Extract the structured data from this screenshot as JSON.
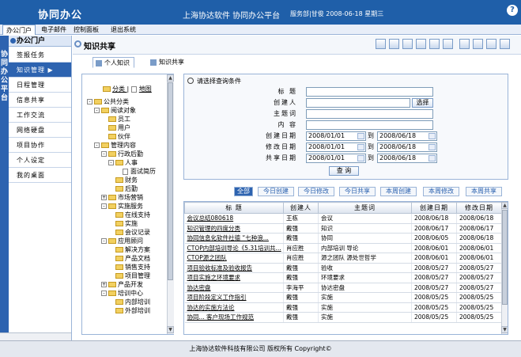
{
  "header": {
    "app_title": "协同办公",
    "platform_title": "上海协达软件 协同办公平台",
    "status": "服务部|甘俊 2008-06-18 星期三",
    "help_icon": "?"
  },
  "topmenu": {
    "items": [
      {
        "label": "办公门户"
      },
      {
        "label": "电子邮件"
      },
      {
        "label": "控制面板"
      },
      {
        "label": "退出系统"
      }
    ]
  },
  "leftnav": {
    "vertical_tab": "协同办公平台",
    "head": "办公门户",
    "items": [
      {
        "label": "签报任务"
      },
      {
        "label": "知识管理 ▶"
      },
      {
        "label": "日程管理"
      },
      {
        "label": "信息共享"
      },
      {
        "label": "工作交流"
      },
      {
        "label": "网络硬盘"
      },
      {
        "label": "项目协作"
      },
      {
        "label": "个人设定"
      },
      {
        "label": "我的桌面"
      }
    ]
  },
  "content": {
    "title": "知识共享",
    "tabs": [
      {
        "label": "个人知识"
      },
      {
        "label": "知识共享"
      }
    ]
  },
  "tree": {
    "switch_category": "分类",
    "switch_map": "地图",
    "nodes": [
      {
        "label": "公共分类",
        "level": 0,
        "type": "folder",
        "expander": "-"
      },
      {
        "label": "阅读对象",
        "level": 1,
        "type": "folder",
        "expander": "-"
      },
      {
        "label": "员工",
        "level": 2,
        "type": "folder",
        "expander": ""
      },
      {
        "label": "用户",
        "level": 2,
        "type": "folder",
        "expander": ""
      },
      {
        "label": "伙伴",
        "level": 2,
        "type": "folder",
        "expander": ""
      },
      {
        "label": "管理内容",
        "level": 1,
        "type": "folder",
        "expander": "-"
      },
      {
        "label": "行政后勤",
        "level": 2,
        "type": "folder",
        "expander": "-"
      },
      {
        "label": "人事",
        "level": 3,
        "type": "folder",
        "expander": "-"
      },
      {
        "label": "面试简历",
        "level": 4,
        "type": "leaf",
        "expander": ""
      },
      {
        "label": "财务",
        "level": 3,
        "type": "folder",
        "expander": ""
      },
      {
        "label": "后勤",
        "level": 3,
        "type": "folder",
        "expander": ""
      },
      {
        "label": "市场营销",
        "level": 2,
        "type": "folder",
        "expander": "+"
      },
      {
        "label": "实施服务",
        "level": 2,
        "type": "folder",
        "expander": "-"
      },
      {
        "label": "在线支持",
        "level": 3,
        "type": "folder",
        "expander": ""
      },
      {
        "label": "实施",
        "level": 3,
        "type": "folder",
        "expander": ""
      },
      {
        "label": "会议记录",
        "level": 3,
        "type": "folder",
        "expander": ""
      },
      {
        "label": "应用顾问",
        "level": 2,
        "type": "folder",
        "expander": "-"
      },
      {
        "label": "解决方案",
        "level": 3,
        "type": "folder",
        "expander": ""
      },
      {
        "label": "产品文档",
        "level": 3,
        "type": "folder",
        "expander": ""
      },
      {
        "label": "销售支持",
        "level": 3,
        "type": "folder",
        "expander": ""
      },
      {
        "label": "项目管理",
        "level": 3,
        "type": "folder",
        "expander": ""
      },
      {
        "label": "产品开发",
        "level": 2,
        "type": "folder",
        "expander": "+"
      },
      {
        "label": "培训中心",
        "level": 2,
        "type": "folder",
        "expander": "-"
      },
      {
        "label": "内部培训",
        "level": 3,
        "type": "folder",
        "expander": ""
      },
      {
        "label": "外部培训",
        "level": 3,
        "type": "folder",
        "expander": ""
      }
    ]
  },
  "search": {
    "title": "请选择查询条件",
    "labels": {
      "title": "标 题",
      "creator": "创建人",
      "keyword": "主题词",
      "content": "内 容",
      "create_date": "创建日期",
      "modify_date": "修改日期",
      "share_date": "共享日期"
    },
    "to_label": "到",
    "select_button": "选择",
    "query_button": "查 询",
    "dates": {
      "create_from": "2008/01/01",
      "create_to": "2008/06/18",
      "modify_from": "2008/01/01",
      "modify_to": "2008/06/18",
      "share_from": "2008/01/01",
      "share_to": "2008/06/18"
    }
  },
  "filters": [
    {
      "label": "全部"
    },
    {
      "label": "今日创建"
    },
    {
      "label": "今日修改"
    },
    {
      "label": "今日共享"
    },
    {
      "label": "本周创建"
    },
    {
      "label": "本周修改"
    },
    {
      "label": "本周共享"
    }
  ],
  "grid": {
    "columns": [
      "标 题",
      "创建人",
      "主题词",
      "创建日期",
      "修改日期"
    ],
    "rows": [
      [
        "会议总结080618",
        "王栋",
        "会议",
        "2008/06/18",
        "2008/06/18"
      ],
      [
        "知识管理的四度分类",
        "戴强",
        "知识",
        "2008/06/17",
        "2008/06/17"
      ],
      [
        "协同信息化软件社德 “七种浪...",
        "戴强",
        "协同",
        "2008/06/05",
        "2008/06/18"
      ],
      [
        "CTOP内部培训导论《5.31培训共...",
        "肖应胜",
        "内部培训 导论",
        "2008/06/01",
        "2008/06/01"
      ],
      [
        "CTOP源之团队",
        "肖应胜",
        "源之团队 源处世哲学",
        "2008/06/01",
        "2008/06/01"
      ],
      [
        "项目验收标准及验收报告",
        "戴强",
        "验收",
        "2008/05/27",
        "2008/05/27"
      ],
      [
        "项目实施之环境要求",
        "戴强",
        "环境要求",
        "2008/05/27",
        "2008/05/27"
      ],
      [
        "协达密盘",
        "李海平",
        "协达密盘",
        "2008/05/27",
        "2008/05/27"
      ],
      [
        "项目阶段定义工作指引",
        "戴强",
        "实施",
        "2008/05/25",
        "2008/05/25"
      ],
      [
        "协达的实施方法论",
        "戴强",
        "实施",
        "2008/05/25",
        "2008/05/25"
      ],
      [
        "协同... 客户现场工作规范",
        "戴强",
        "实施",
        "2008/05/25",
        "2008/05/25"
      ]
    ]
  },
  "footer": {
    "text": "上海协达软件科技有限公司 版权所有 Copyright©"
  }
}
